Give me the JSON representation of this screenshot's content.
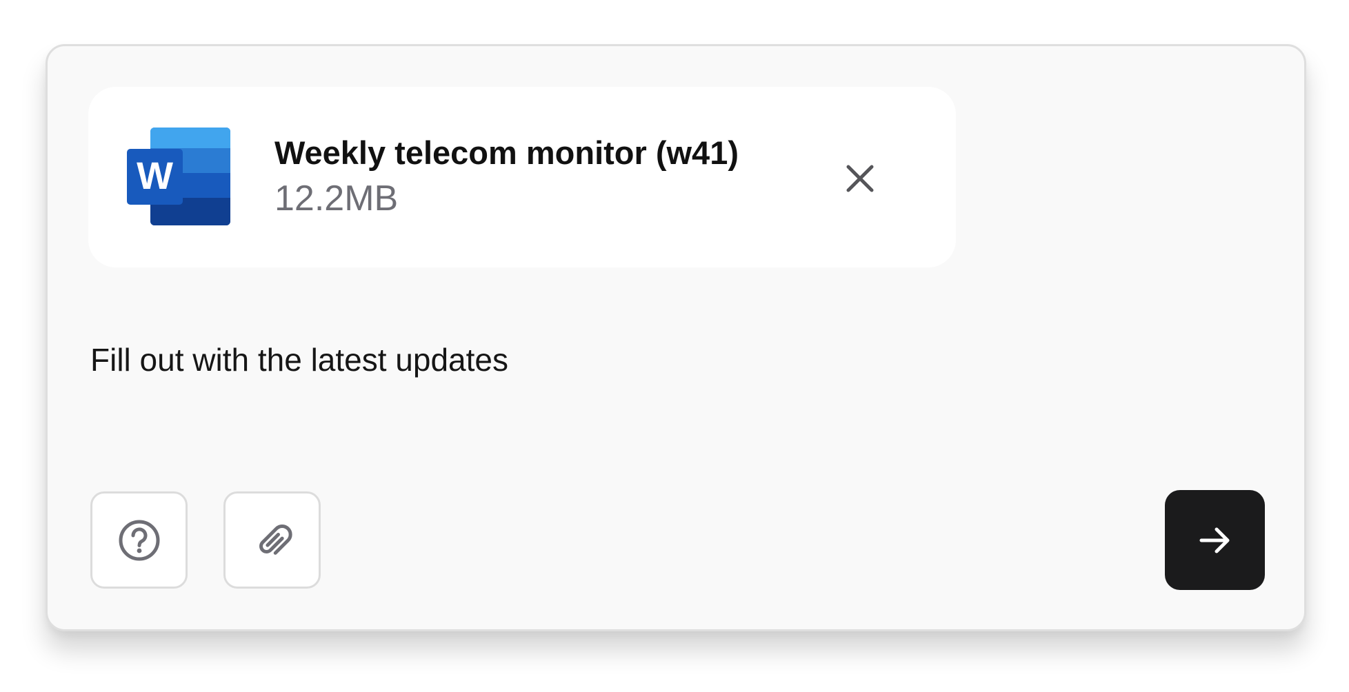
{
  "attachment": {
    "file_name": "Weekly telecom monitor (w41)",
    "file_size": "12.2MB",
    "file_icon": "word-icon",
    "file_icon_letter": "W",
    "remove_icon": "close-icon"
  },
  "prompt": {
    "text": "Fill out with the latest updates"
  },
  "toolbar": {
    "help_icon": "question-circle-icon",
    "attach_icon": "paperclip-icon",
    "send_icon": "arrow-right-icon"
  },
  "colors": {
    "panel_background": "#f9f9f9",
    "card_background": "#ffffff",
    "send_button": "#1b1b1c",
    "word_blue": "#185abd",
    "muted_text": "#6e6e75"
  }
}
